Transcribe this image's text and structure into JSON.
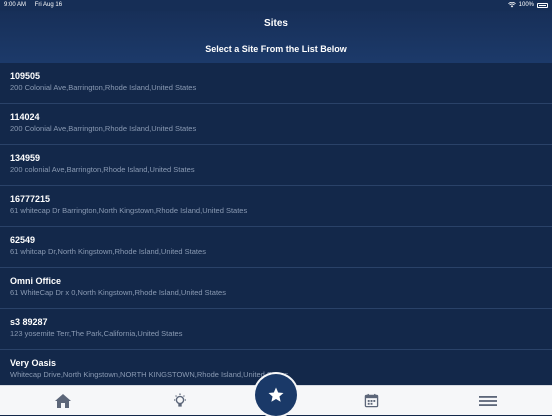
{
  "status_bar": {
    "time": "9:00 AM",
    "date": "Fri Aug 16",
    "battery": "100%"
  },
  "header": {
    "title": "Sites",
    "subtitle": "Select a Site From the List Below"
  },
  "sites": [
    {
      "name": "109505",
      "address": "200 Colonial Ave,Barrington,Rhode Island,United States"
    },
    {
      "name": "114024",
      "address": "200 Colonial Ave,Barrington,Rhode Island,United States"
    },
    {
      "name": "134959",
      "address": "200 colonial Ave,Barrington,Rhode Island,United States"
    },
    {
      "name": "16777215",
      "address": "61 whitecap Dr Barrington,North Kingstown,Rhode Island,United States"
    },
    {
      "name": "62549",
      "address": "61 whitcap Dr,North Kingstown,Rhode Island,United States"
    },
    {
      "name": "Omni Office",
      "address": "61 WhiteCap Dr x 0,North Kingstown,Rhode Island,United States"
    },
    {
      "name": "s3 89287",
      "address": "123 yosemite Terr,The Park,California,United States"
    },
    {
      "name": "Very Oasis",
      "address": "Whitecap Drive,North Kingstown,NORTH KINGSTOWN,Rhode Island,United States"
    }
  ],
  "tabs": {
    "home_icon": "home-icon",
    "tips_icon": "lightbulb-icon",
    "favorites_icon": "star-icon",
    "calendar_icon": "calendar-icon",
    "menu_icon": "menu-icon"
  },
  "colors": {
    "background": "#13284a",
    "header": "#1c3a6a",
    "address_text": "#8a9ab3",
    "tab_bar": "#f6f7f9",
    "tab_icon": "#5c6679",
    "active_tab": "#1a3968"
  }
}
